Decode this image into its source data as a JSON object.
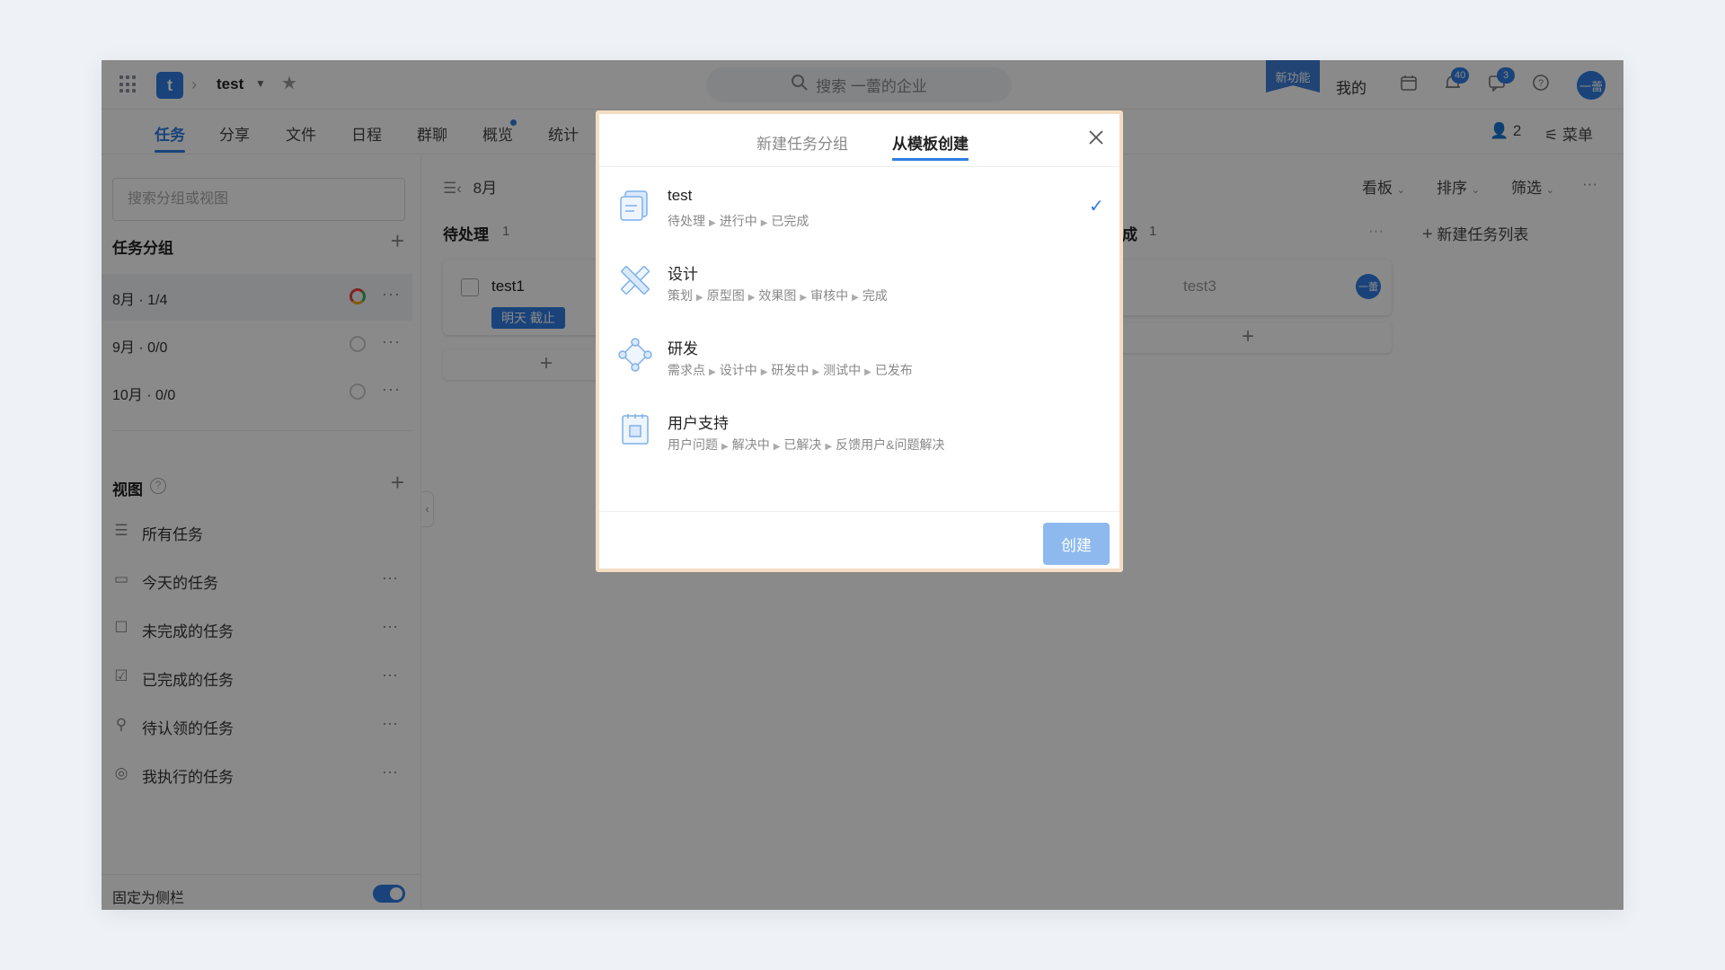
{
  "topbar": {
    "project_initial": "t",
    "project_name": "test",
    "search_placeholder": "搜索 一蕾的企业",
    "new_feature": "新功能",
    "mine": "我的",
    "bell_count": "40",
    "msg_count": "3",
    "avatar_text": "一蕾"
  },
  "tabs": [
    "任务",
    "分享",
    "文件",
    "日程",
    "群聊",
    "概览",
    "统计"
  ],
  "tabbar_right": {
    "members": "2",
    "menu": "菜单"
  },
  "sidebar": {
    "search_placeholder": "搜索分组或视图",
    "groups_title": "任务分组",
    "groups": [
      {
        "label": "8月 · 1/4"
      },
      {
        "label": "9月 · 0/0"
      },
      {
        "label": "10月 · 0/0"
      }
    ],
    "views_title": "视图",
    "views": [
      {
        "label": "所有任务",
        "icon": "list-icon"
      },
      {
        "label": "今天的任务",
        "icon": "calendar-icon"
      },
      {
        "label": "未完成的任务",
        "icon": "checkbox-empty-icon"
      },
      {
        "label": "已完成的任务",
        "icon": "checkbox-checked-icon"
      },
      {
        "label": "待认领的任务",
        "icon": "person-icon"
      },
      {
        "label": "我执行的任务",
        "icon": "user-circle-icon"
      }
    ],
    "pin_label": "固定为侧栏"
  },
  "board": {
    "group_title": "8月",
    "tools": [
      "看板",
      "排序",
      "筛选"
    ],
    "columns": [
      {
        "title": "待处理",
        "count": "1",
        "card_title": "test1",
        "due": "明天 截止"
      },
      {
        "title": "成",
        "count": "1",
        "card_title": "test3",
        "avatar": "一蕾"
      }
    ],
    "new_list": "新建任务列表"
  },
  "modal": {
    "tab_new_group": "新建任务分组",
    "tab_from_template": "从模板创建",
    "templates": [
      {
        "name": "test",
        "steps": [
          "待处理",
          "进行中",
          "已完成"
        ],
        "selected": true
      },
      {
        "name": "设计",
        "steps": [
          "策划",
          "原型图",
          "效果图",
          "审核中",
          "完成"
        ]
      },
      {
        "name": "研发",
        "steps": [
          "需求点",
          "设计中",
          "研发中",
          "测试中",
          "已发布"
        ]
      },
      {
        "name": "用户支持",
        "steps": [
          "用户问题",
          "解决中",
          "已解决",
          "反馈用户&问题解决"
        ]
      }
    ],
    "create_button": "创建"
  },
  "colors": {
    "accent": "#2f7de1",
    "create_btn": "#8db9ee",
    "modal_border": "#f4ddc4"
  }
}
